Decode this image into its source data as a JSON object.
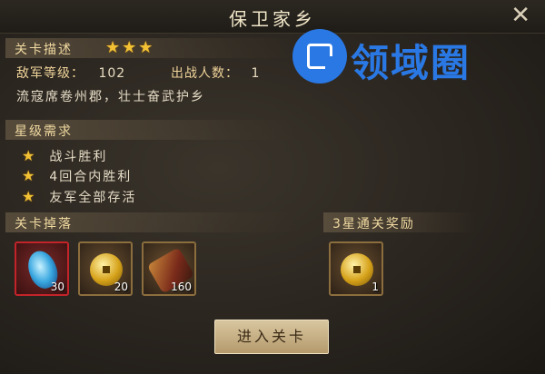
{
  "title": "保卫家乡",
  "close_icon": "close-icon",
  "stage": {
    "desc_label": "关卡描述",
    "stars": "★★★",
    "enemy_level_label": "敌军等级：",
    "enemy_level": "102",
    "deploy_label": "出战人数：",
    "deploy_count": "1",
    "description": "流寇席卷州郡，壮士奋武护乡"
  },
  "star_requirements": {
    "label": "星级需求",
    "items": [
      "战斗胜利",
      "4回合内胜利",
      "友军全部存活"
    ]
  },
  "drops": {
    "label": "关卡掉落",
    "items": [
      {
        "icon": "blue-gem-icon",
        "count": "30"
      },
      {
        "icon": "gold-coin-icon",
        "count": "20"
      },
      {
        "icon": "scroll-icon",
        "count": "160"
      }
    ]
  },
  "reward": {
    "label": "3星通关奖励",
    "items": [
      {
        "icon": "gold-coin-icon",
        "count": "1"
      }
    ]
  },
  "enter_button": "进入关卡",
  "watermark": "领域圈",
  "colors": {
    "star": "#f2c234",
    "accent_border": "#8c6e3e",
    "selected_border": "#c2242a"
  }
}
